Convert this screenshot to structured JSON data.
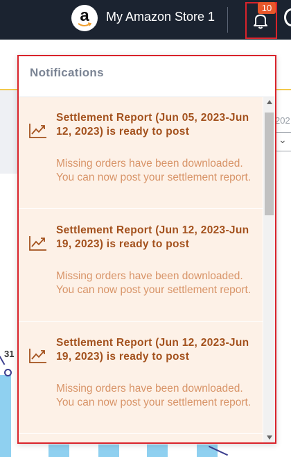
{
  "header": {
    "store_name": "My Amazon Store 1",
    "store_logo_letter": "a",
    "notification_count": "10"
  },
  "background": {
    "year_fragment": "202",
    "chart_value_fragment": "31"
  },
  "notifications": {
    "title": "Notifications",
    "items": [
      {
        "icon": "trending-up-icon",
        "title": "Settlement Report (Jun 05, 2023-Jun 12, 2023) is ready to post",
        "message": "Missing orders have been downloaded. You can now post your settlement report."
      },
      {
        "icon": "trending-up-icon",
        "title": "Settlement Report (Jun 12, 2023-Jun 19, 2023) is ready to post",
        "message": "Missing orders have been downloaded. You can now post your settlement report."
      },
      {
        "icon": "trending-up-icon",
        "title": "Settlement Report (Jun 12, 2023-Jun 19, 2023) is ready to post",
        "message": "Missing orders have been downloaded. You can now post your settlement report."
      }
    ]
  },
  "colors": {
    "topbar": "#1b2330",
    "highlight": "#d9232b",
    "badge": "#e8572a",
    "notification_bg": "#fdf1e7",
    "notification_title": "#a3511d",
    "notification_text": "#d89468"
  }
}
